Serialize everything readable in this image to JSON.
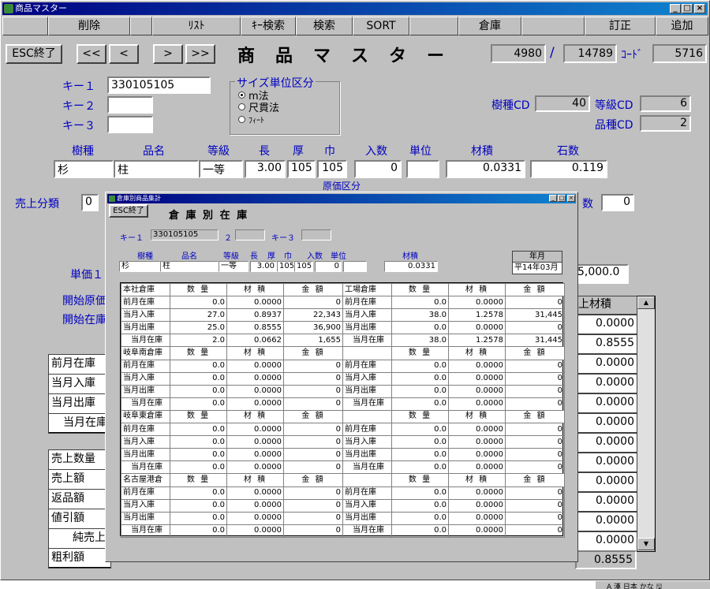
{
  "window": {
    "title": "商品マスター"
  },
  "fkeys": [
    "削除",
    "ﾘｽﾄ",
    "ｷｰ検索",
    "検索",
    "SORT",
    "倉庫",
    "訂正",
    "追加"
  ],
  "nav": {
    "esc": "ESC終了",
    "first": "<<",
    "prev": "<",
    "next": ">",
    "last": ">>"
  },
  "heading": "商　品　マ　ス　タ　ー",
  "counter": {
    "current": "4980",
    "slash": "/",
    "total": "14789",
    "code_label": "ｺｰﾄﾞ",
    "code": "5716"
  },
  "keys": {
    "key1_label": "キー１",
    "key1": "330105105",
    "key2_label": "キー２",
    "key2": "",
    "key3_label": "キー３",
    "key3": ""
  },
  "size_unit": {
    "title": "サイズ単位区分",
    "options": [
      "m法",
      "尺貫法",
      "ﾌｨｰﾄ"
    ],
    "selected": 0
  },
  "cd": {
    "jushu_label": "樹種CD",
    "jushu": "40",
    "tokyu_label": "等級CD",
    "tokyu": "6",
    "hinshu_label": "品種CD",
    "hinshu": "2"
  },
  "product_headers": [
    "樹種",
    "品名",
    "等級",
    "長",
    "厚",
    "巾",
    "入数",
    "単位",
    "材積",
    "石数"
  ],
  "product": {
    "jushu": "杉",
    "hinmei": "柱",
    "tokyu": "一等",
    "length": "3.00",
    "thick": "105",
    "width": "105",
    "irisu": "0",
    "tani": "",
    "zaiseki": "0.0331",
    "kokusu": "0.119"
  },
  "bg": {
    "sales_class_label": "売上分類",
    "sales_class": "0",
    "genka_partial": "原価区分",
    "count_partial": "数",
    "count": "0",
    "tanka_label": "単価１",
    "tanka_value": "5,000.0",
    "start_cost_label": "開始原価",
    "start_stock_label": "開始在庫",
    "col_header_partial": "上材積",
    "stock_rows": [
      "前月在庫",
      "当月入庫",
      "当月出庫",
      "当月在庫"
    ],
    "sales_rows": [
      "売上数量",
      "売上額",
      "返品額",
      "値引額",
      "純売上",
      "粗利額"
    ],
    "right_values": [
      "0.0000",
      "0.8555",
      "0.0000",
      "0.0000",
      "0.0000",
      "0.0000",
      "0.0000",
      "0.0000",
      "0.0000",
      "0.0000",
      "0.0000",
      "0.0000"
    ],
    "bottom_value": "0.8555"
  },
  "popup": {
    "title": "倉庫別商品集計",
    "esc": "ESC終了",
    "heading": "倉 庫 別 在 庫",
    "key1_label": "キー１",
    "key1": "330105105",
    "key2_label": "２",
    "key2": "",
    "key3_label": "キー３",
    "key3": "",
    "headers": [
      "樹種",
      "品名",
      "等級",
      "長",
      "厚",
      "巾",
      "入数",
      "単位",
      "材積"
    ],
    "product": {
      "jushu": "杉",
      "hinmei": "柱",
      "tokyu": "一等",
      "length": "3.00",
      "thick": "105",
      "width": "105",
      "irisu": "0",
      "tani": "",
      "zaiseki": "0.0331"
    },
    "ym_label": "年月",
    "ym": "平14年03月",
    "col_headers": [
      "数 量",
      "材 積",
      "金 額"
    ],
    "warehouses": [
      {
        "left": {
          "name": "本社倉庫",
          "rows": [
            [
              "前月在庫",
              "0.0",
              "0.0000",
              "0"
            ],
            [
              "当月入庫",
              "27.0",
              "0.8937",
              "22,343"
            ],
            [
              "当月出庫",
              "25.0",
              "0.8555",
              "36,900"
            ],
            [
              "当月在庫",
              "2.0",
              "0.0662",
              "1,655"
            ]
          ]
        },
        "right": {
          "name": "工場倉庫",
          "rows": [
            [
              "前月在庫",
              "0.0",
              "0.0000",
              "0"
            ],
            [
              "当月入庫",
              "38.0",
              "1.2578",
              "31,445"
            ],
            [
              "当月出庫",
              "0.0",
              "0.0000",
              "0"
            ],
            [
              "当月在庫",
              "38.0",
              "1.2578",
              "31,445"
            ]
          ]
        }
      },
      {
        "left": {
          "name": "岐阜南倉庫",
          "rows": [
            [
              "前月在庫",
              "0.0",
              "0.0000",
              "0"
            ],
            [
              "当月入庫",
              "0.0",
              "0.0000",
              "0"
            ],
            [
              "当月出庫",
              "0.0",
              "0.0000",
              "0"
            ],
            [
              "当月在庫",
              "0.0",
              "0.0000",
              "0"
            ]
          ]
        },
        "right": {
          "name": "",
          "rows": [
            [
              "前月在庫",
              "0.0",
              "0.0000",
              "0"
            ],
            [
              "当月入庫",
              "0.0",
              "0.0000",
              "0"
            ],
            [
              "当月出庫",
              "0.0",
              "0.0000",
              "0"
            ],
            [
              "当月在庫",
              "0.0",
              "0.0000",
              "0"
            ]
          ]
        }
      },
      {
        "left": {
          "name": "岐阜東倉庫",
          "rows": [
            [
              "前月在庫",
              "0.0",
              "0.0000",
              "0"
            ],
            [
              "当月入庫",
              "0.0",
              "0.0000",
              "0"
            ],
            [
              "当月出庫",
              "0.0",
              "0.0000",
              "0"
            ],
            [
              "当月在庫",
              "0.0",
              "0.0000",
              "0"
            ]
          ]
        },
        "right": {
          "name": "",
          "rows": [
            [
              "前月在庫",
              "0.0",
              "0.0000",
              "0"
            ],
            [
              "当月入庫",
              "0.0",
              "0.0000",
              "0"
            ],
            [
              "当月出庫",
              "0.0",
              "0.0000",
              "0"
            ],
            [
              "当月在庫",
              "0.0",
              "0.0000",
              "0"
            ]
          ]
        }
      },
      {
        "left": {
          "name": "名古屋港倉",
          "rows": [
            [
              "前月在庫",
              "0.0",
              "0.0000",
              "0"
            ],
            [
              "当月入庫",
              "0.0",
              "0.0000",
              "0"
            ],
            [
              "当月出庫",
              "0.0",
              "0.0000",
              "0"
            ],
            [
              "当月在庫",
              "0.0",
              "0.0000",
              "0"
            ]
          ]
        },
        "right": {
          "name": "",
          "rows": [
            [
              "前月在庫",
              "0.0",
              "0.0000",
              "0"
            ],
            [
              "当月入庫",
              "0.0",
              "0.0000",
              "0"
            ],
            [
              "当月出庫",
              "0.0",
              "0.0000",
              "0"
            ],
            [
              "当月在庫",
              "0.0",
              "0.0000",
              "0"
            ]
          ]
        }
      }
    ]
  },
  "taskbar": {
    "text": "A 漢 日本 かな 🖫"
  }
}
